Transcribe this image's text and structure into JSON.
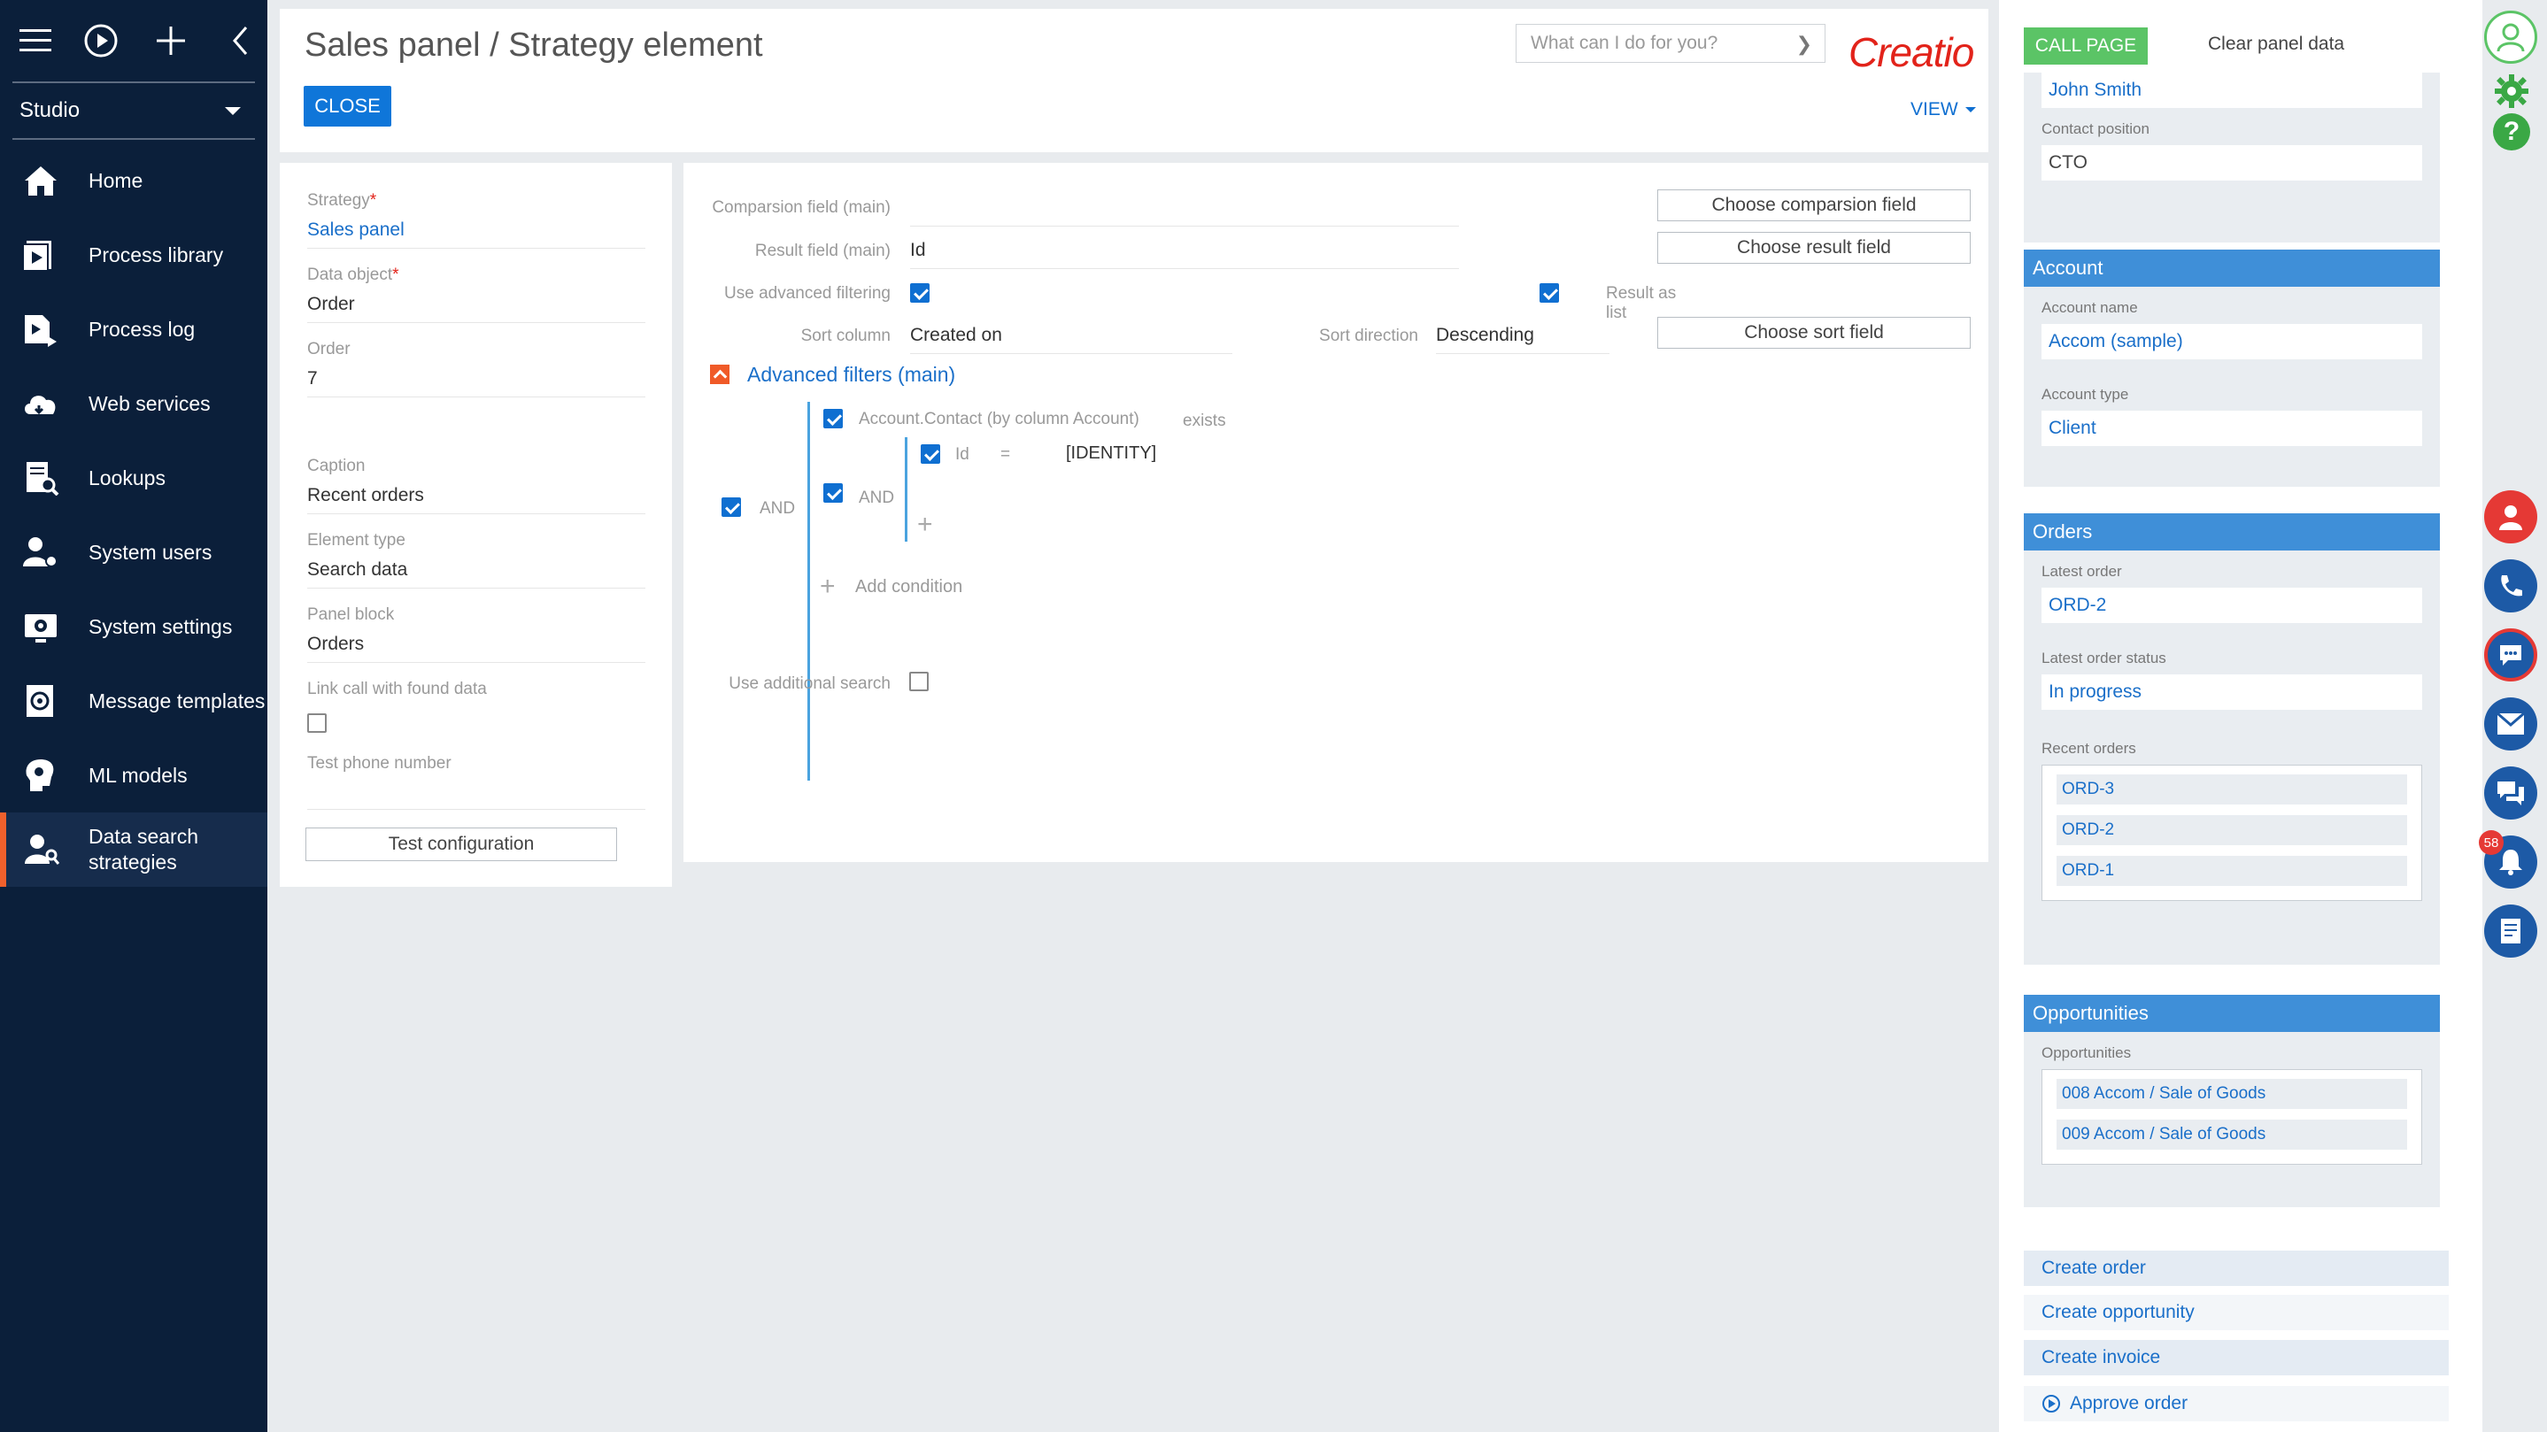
{
  "sidebar": {
    "studio_label": "Studio",
    "items": [
      {
        "label": "Home",
        "icon": "home-icon"
      },
      {
        "label": "Process library",
        "icon": "process-library-icon"
      },
      {
        "label": "Process log",
        "icon": "process-log-icon"
      },
      {
        "label": "Web services",
        "icon": "web-services-icon"
      },
      {
        "label": "Lookups",
        "icon": "lookups-icon"
      },
      {
        "label": "System users",
        "icon": "system-users-icon"
      },
      {
        "label": "System settings",
        "icon": "system-settings-icon"
      },
      {
        "label": "Message templates",
        "icon": "message-templates-icon"
      },
      {
        "label": "ML models",
        "icon": "ml-models-icon"
      },
      {
        "label": "Data search strategies",
        "icon": "data-search-icon"
      }
    ],
    "active_index": 9
  },
  "header": {
    "title": "Sales panel / Strategy element",
    "close_label": "CLOSE",
    "search_placeholder": "What can I do for you?",
    "logo": "Creatio",
    "view_label": "VIEW"
  },
  "left": {
    "strategy_label": "Strategy",
    "strategy_value": "Sales panel",
    "data_object_label": "Data object",
    "data_object_value": "Order",
    "order_label": "Order",
    "order_value": "7",
    "caption_label": "Caption",
    "caption_value": "Recent orders",
    "element_type_label": "Element type",
    "element_type_value": "Search data",
    "panel_block_label": "Panel block",
    "panel_block_value": "Orders",
    "link_call_label": "Link call with found data",
    "link_call_checked": false,
    "test_phone_label": "Test phone number",
    "test_phone_value": "",
    "test_button": "Test configuration"
  },
  "main": {
    "comparison_label": "Comparsion field (main)",
    "comparison_value": "",
    "result_label": "Result field (main)",
    "result_value": "Id",
    "advanced_filtering_label": "Use advanced filtering",
    "result_as_list_label": "Result as list",
    "sort_column_label": "Sort column",
    "sort_column_value": "Created on",
    "sort_direction_label": "Sort direction",
    "sort_direction_value": "Descending",
    "choose_comparison": "Choose comparsion field",
    "choose_result": "Choose result field",
    "choose_sort": "Choose sort field",
    "advanced_filters_title": "Advanced filters (main)",
    "filter": {
      "and_outer": "AND",
      "group_condition": "Account.Contact (by column Account)",
      "group_exists": "exists",
      "and_inner": "AND",
      "field": "Id",
      "operator": "=",
      "value": "[IDENTITY]",
      "add_condition": "Add condition"
    },
    "additional_search_label": "Use additional search"
  },
  "panel": {
    "call_page": "CALL PAGE",
    "clear_data": "Clear panel data",
    "contact_name_value": "John Smith",
    "contact_position_label": "Contact position",
    "contact_position_value": "CTO",
    "account_header": "Account",
    "account_name_label": "Account name",
    "account_name_value": "Accom (sample)",
    "account_type_label": "Account type",
    "account_type_value": "Client",
    "orders_header": "Orders",
    "latest_order_label": "Latest order",
    "latest_order_value": "ORD-2",
    "latest_status_label": "Latest order status",
    "latest_status_value": "In progress",
    "recent_orders_label": "Recent orders",
    "recent_orders": [
      "ORD-3",
      "ORD-2",
      "ORD-1"
    ],
    "opps_header": "Opportunities",
    "opps_label": "Opportunities",
    "opps": [
      "008 Accom / Sale of Goods",
      "009 Accom / Sale of Goods"
    ],
    "actions": [
      "Create order",
      "Create opportunity",
      "Create invoice",
      "Approve order"
    ]
  },
  "notifications_count": "58",
  "colors": {
    "sidebar": "#0b1f3a",
    "accent": "#0f76d9",
    "brand": "#e2231a",
    "panel_header": "#3f8fd8",
    "call_page": "#5bc466"
  }
}
